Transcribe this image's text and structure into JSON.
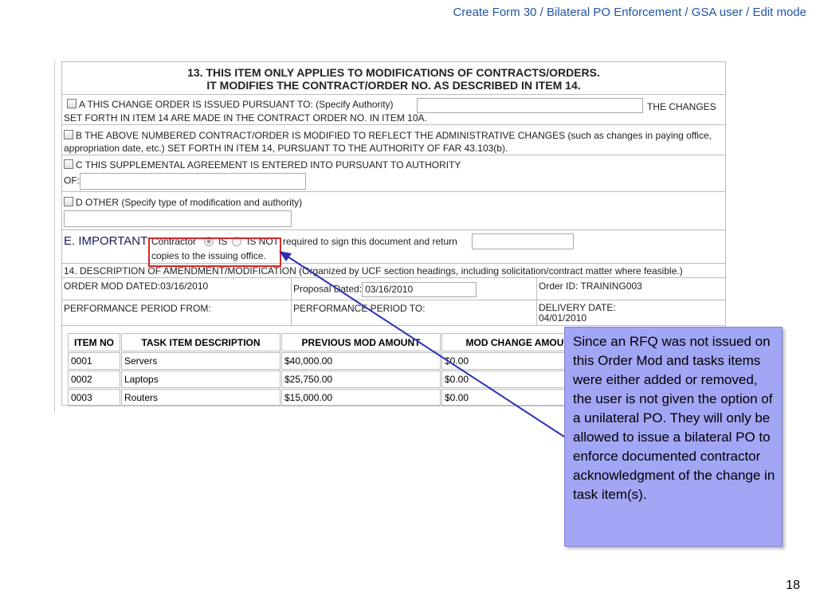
{
  "slide": {
    "title": "Create Form 30 / Bilateral PO Enforcement / GSA user / Edit mode",
    "page_number": "18"
  },
  "form": {
    "header_line1": "13. THIS ITEM ONLY APPLIES TO MODIFICATIONS OF CONTRACTS/ORDERS.",
    "header_line2": "IT MODIFIES THE CONTRACT/ORDER NO. AS DESCRIBED IN ITEM 14.",
    "option_a_text": "A THIS CHANGE ORDER IS ISSUED PURSUANT TO: (Specify Authority)",
    "option_a_tail": "THE CHANGES",
    "option_a_line2": "SET FORTH IN ITEM 14 ARE MADE IN THE CONTRACT ORDER NO. IN ITEM 10A.",
    "option_a_value": "",
    "option_b_text": "B THE ABOVE NUMBERED CONTRACT/ORDER IS MODIFIED TO REFLECT THE ADMINISTRATIVE CHANGES (such as changes in paying office, appropriation date, etc.) SET FORTH IN ITEM 14, PURSUANT TO THE AUTHORITY OF FAR 43.103(b).",
    "option_c_text": "C THIS SUPPLEMENTAL AGREEMENT IS ENTERED INTO PURSUANT TO AUTHORITY",
    "option_c_of_label": "OF:",
    "option_c_value": "",
    "option_d_text": "D OTHER (Specify type of modification and authority)",
    "option_d_value": "",
    "important_label": "E. IMPORTANT",
    "contractor_label": "Contractor",
    "is_label": "IS",
    "is_not_label": "IS NOT",
    "required_text": "required to sign this document and return",
    "copies_value": "",
    "copies_text": "copies to  the issuing office.",
    "item14_text": "14. DESCRIPTION OF AMENDMENT/MODIFICATION (Organized by UCF section headings, including solicitation/contract matter where feasible.)",
    "order_mod_dated": "ORDER MOD DATED:03/16/2010",
    "proposal_dated_label": "Proposal Dated:",
    "proposal_dated_value": "03/16/2010",
    "order_id": "Order ID: TRAINING003",
    "perf_from": "PERFORMANCE PERIOD FROM:",
    "perf_to": "PERFORMANCE PERIOD TO:",
    "delivery_date_label": "DELIVERY DATE:",
    "delivery_date_value": "04/01/2010"
  },
  "task_table": {
    "headers": [
      "ITEM NO",
      "TASK ITEM DESCRIPTION",
      "PREVIOUS MOD AMOUNT",
      "MOD CHANGE AMOUNT"
    ],
    "rows": [
      [
        "0001",
        "Servers",
        "$40,000.00",
        "$0.00"
      ],
      [
        "0002",
        "Laptops",
        "$25,750.00",
        "$0.00"
      ],
      [
        "0003",
        "Routers",
        "$15,000.00",
        "$0.00"
      ]
    ]
  },
  "callout": {
    "text": "Since an RFQ was not issued on this Order Mod and tasks items were either added or removed, the user is not given the option of a unilateral PO. They will only be allowed to issue a bilateral PO to enforce documented contractor acknowledgment of the change in task item(s)."
  },
  "colors": {
    "title_blue": "#2255a4",
    "highlight_red": "#d22a2a",
    "callout_fill": "#a3a5f5",
    "arrow": "#2d2fb5"
  }
}
